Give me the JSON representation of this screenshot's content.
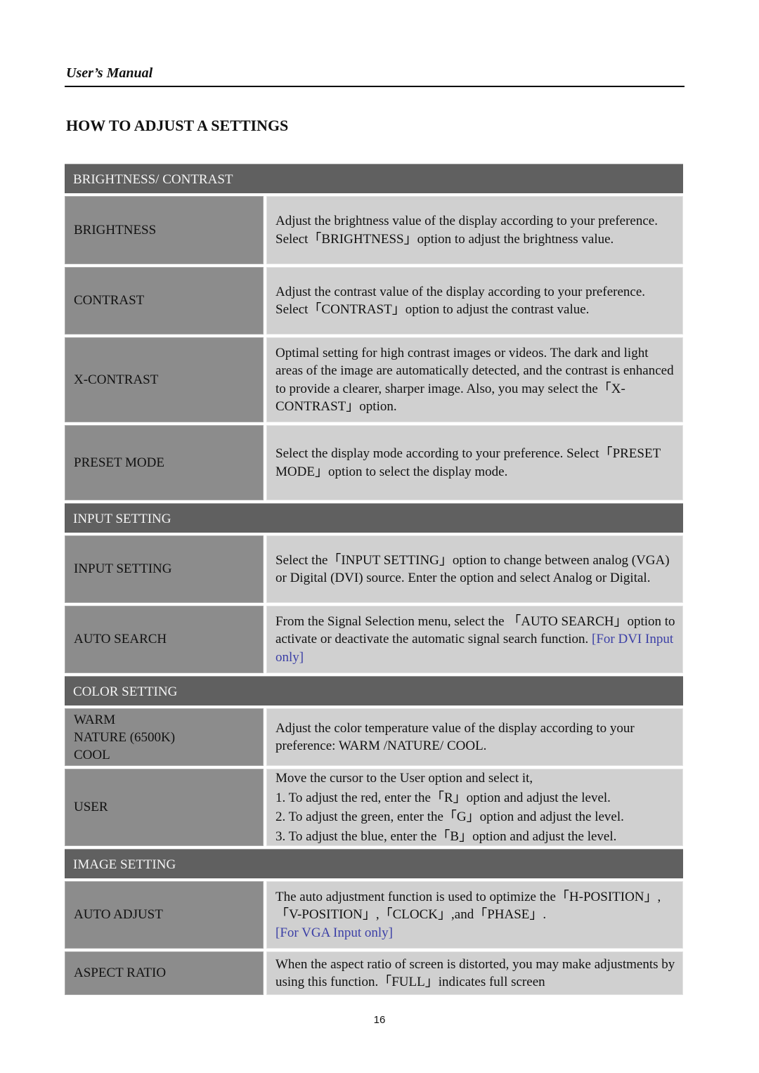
{
  "header": {
    "running_head": "User’s Manual"
  },
  "title": "HOW TO ADJUST A SETTINGS",
  "sections": [
    {
      "heading": "BRIGHTNESS/ CONTRAST",
      "rows": [
        {
          "label": "BRIGHTNESS",
          "text": "Adjust the brightness value of the display according to your preference. Select「BRIGHTNESS」option to adjust the brightness value."
        },
        {
          "label": "CONTRAST",
          "text": "Adjust the contrast value of the display according to your preference. Select「CONTRAST」option to adjust the contrast value."
        },
        {
          "label": "X-CONTRAST",
          "text": "Optimal setting for high contrast images or videos. The dark and light areas of the image are automatically detected, and the contrast is enhanced to provide a clearer, sharper image. Also, you may select the「X-CONTRAST」option."
        },
        {
          "label": "PRESET MODE",
          "text": "Select the display mode according to your preference. Select「PRESET MODE」option to select the display mode."
        }
      ]
    },
    {
      "heading": "INPUT SETTING",
      "rows": [
        {
          "label": "INPUT SETTING",
          "text": "Select the「INPUT SETTING」option to change between analog (VGA) or Digital (DVI) source. Enter the option and select Analog or Digital."
        },
        {
          "label": "AUTO SEARCH",
          "text": "From the Signal Selection menu, select the 「AUTO SEARCH」option to activate or deactivate the automatic signal search function.",
          "note": "[For DVI Input only]"
        }
      ]
    },
    {
      "heading": "COLOR SETTING",
      "rows": [
        {
          "label_lines": [
            "WARM",
            "NATURE (6500K)",
            "COOL"
          ],
          "text": "Adjust the color temperature value of the display according to your preference: WARM /NATURE/ COOL."
        },
        {
          "label": "USER",
          "lines": [
            "Move the cursor to the User option and select it,",
            "1. To adjust the red, enter the「R」option and adjust the level.",
            "2. To adjust the green, enter the「G」option and adjust the level.",
            "3. To adjust the blue, enter the「B」option and adjust the level."
          ]
        }
      ]
    },
    {
      "heading": "IMAGE SETTING",
      "rows": [
        {
          "label": "AUTO ADJUST",
          "text": "The auto adjustment function is used to optimize the「H-POSITION」,「V-POSITION」,「CLOCK」,and「PHASE」.",
          "note": "[For VGA Input only]"
        },
        {
          "label": "ASPECT RATIO",
          "text": "When the aspect ratio of screen is distorted, you may make adjustments by using this function.「FULL」indicates full screen"
        }
      ]
    }
  ],
  "footer": {
    "page_number": "16"
  },
  "colors": {
    "band": "#606060",
    "label_cell": "#8c8c8c",
    "desc_cell": "#d0d0d0",
    "note": "#3b3fa6"
  }
}
